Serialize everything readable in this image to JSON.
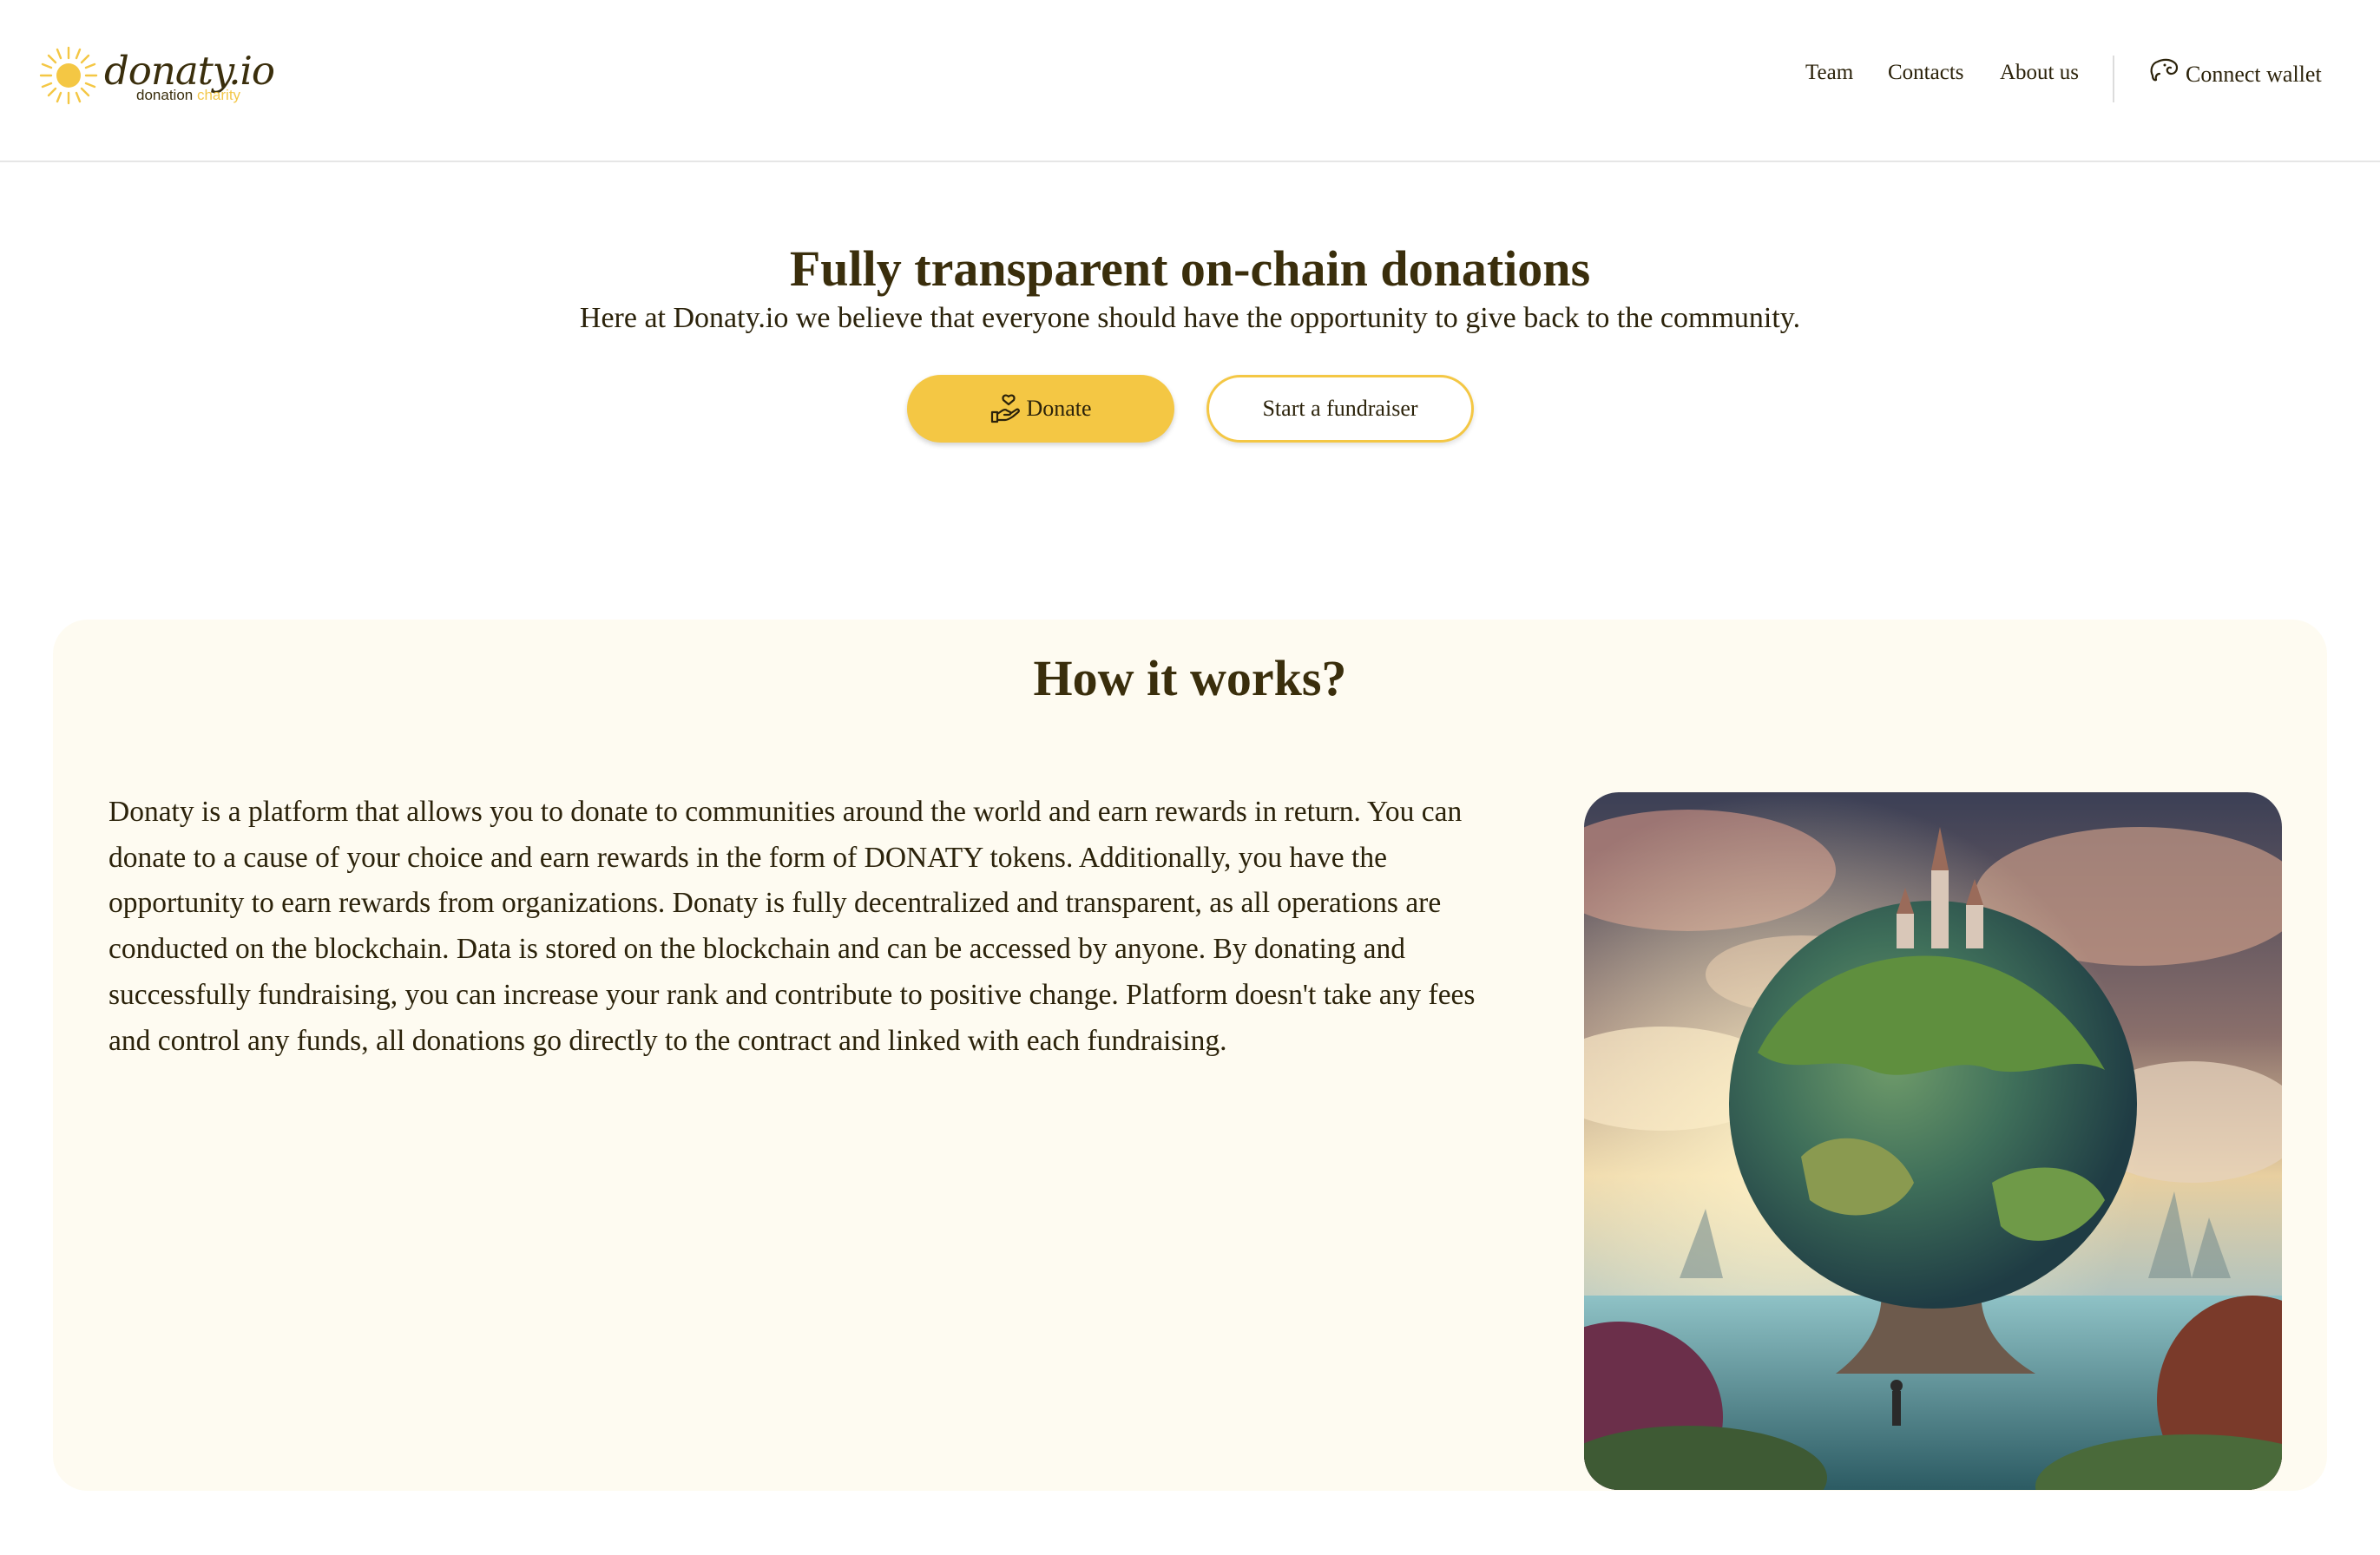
{
  "header": {
    "logo": {
      "name": "donaty.io",
      "tagline_part1": "donation",
      "tagline_part2": "charity",
      "icon": "sun-icon"
    },
    "nav": {
      "team": "Team",
      "contacts": "Contacts",
      "about": "About us"
    },
    "wallet": {
      "label": "Connect wallet",
      "icon": "wallet-icon"
    }
  },
  "hero": {
    "title": "Fully transparent on-chain donations",
    "subtitle": "Here at Donaty.io we believe that everyone should have the opportunity to give back to the community.",
    "donate_label": "Donate",
    "donate_icon": "hand-heart-icon",
    "fundraiser_label": "Start a fundraiser"
  },
  "how": {
    "title": "How it works?",
    "description": "Donaty is a platform that allows you to donate to communities around the world and earn rewards in return. You can donate to a cause of your choice and earn rewards in the form of DONATY tokens. Additionally, you have the opportunity to earn rewards from organizations. Donaty is fully decentralized and transparent, as all operations are conducted on the blockchain. Data is stored on the blockchain and can be accessed by anyone. By donating and successfully fundraising, you can increase your rank and contribute to positive change. Platform doesn't take any fees and control any funds, all donations go directly to the contract and linked with each fundraising.",
    "image": "fantasy-globe-tree-illustration"
  },
  "colors": {
    "accent": "#f4c744",
    "text": "#3a2e0c",
    "card_background": "#fefbf1"
  }
}
